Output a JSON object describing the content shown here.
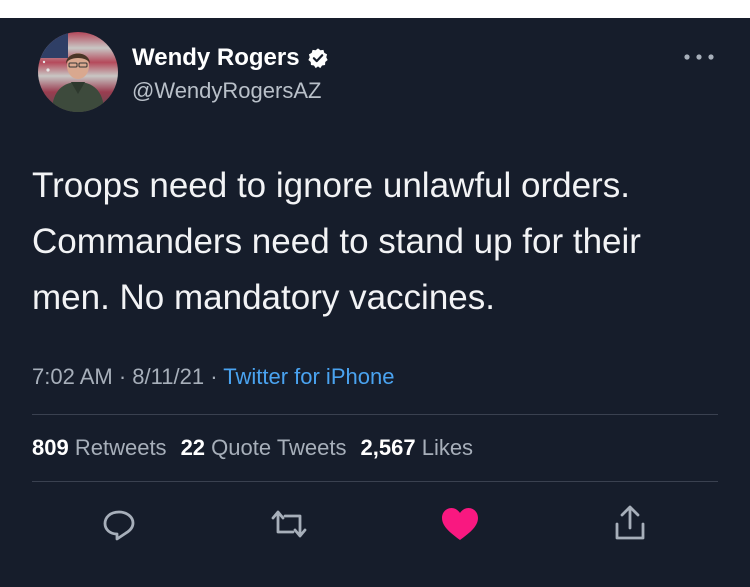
{
  "tweet": {
    "author_name": "Wendy Rogers",
    "author_handle": "@WendyRogersAZ",
    "text": "Troops need to ignore unlawful orders. Commanders need to stand up for their men. No mandatory vaccines.",
    "time": "7:02 AM",
    "date": "8/11/21",
    "source": "Twitter for iPhone",
    "separator": "·"
  },
  "stats": {
    "retweets_count": "809",
    "retweets_label": "Retweets",
    "quotes_count": "22",
    "quotes_label": "Quote Tweets",
    "likes_count": "2,567",
    "likes_label": "Likes"
  },
  "actions": [
    {
      "icon": "reply-icon"
    },
    {
      "icon": "retweet-icon"
    },
    {
      "icon": "like-icon",
      "liked": true,
      "color": "#f91880"
    },
    {
      "icon": "share-icon"
    }
  ],
  "colors": {
    "background": "#161d2b",
    "link": "#4aa3f0",
    "verified": "#ffffff"
  }
}
